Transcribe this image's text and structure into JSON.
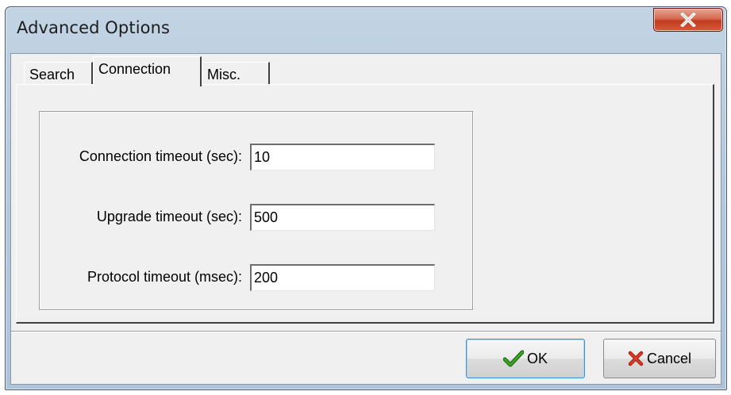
{
  "window": {
    "title": "Advanced Options"
  },
  "tabs": [
    {
      "label": "Search",
      "active": false
    },
    {
      "label": "Connection",
      "active": true
    },
    {
      "label": "Misc.",
      "active": false
    }
  ],
  "connection": {
    "fields": [
      {
        "label": "Connection timeout (sec):",
        "value": "10"
      },
      {
        "label": "Upgrade timeout (sec):",
        "value": "500"
      },
      {
        "label": "Protocol timeout (msec):",
        "value": "200"
      }
    ]
  },
  "buttons": {
    "ok_label": "OK",
    "cancel_label": "Cancel"
  },
  "icons": {
    "close": "close-icon",
    "ok": "checkmark-icon",
    "cancel": "x-mark-icon"
  },
  "colors": {
    "close_button": "#c9472b",
    "ok_check": "#2a7a1a",
    "cancel_x": "#c0281a"
  }
}
